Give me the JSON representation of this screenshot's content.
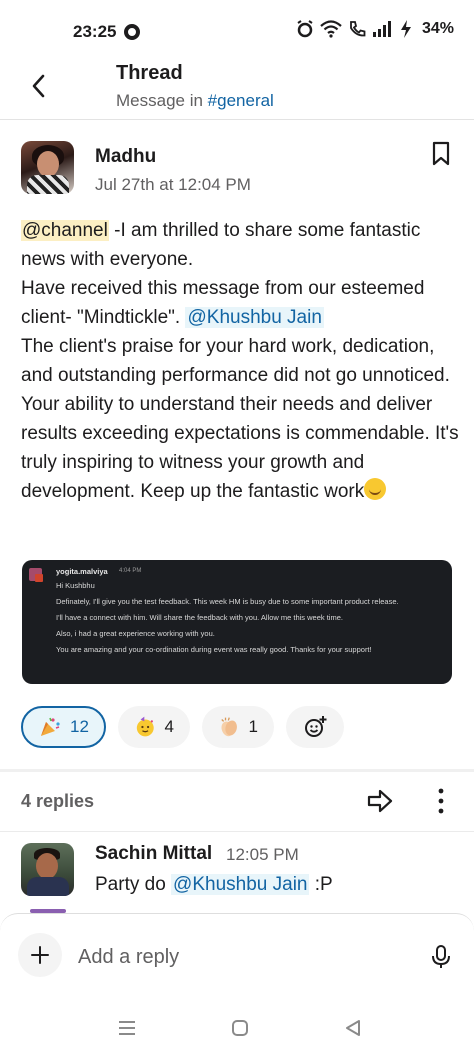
{
  "status_bar": {
    "time": "23:25",
    "battery": "34%",
    "icons": [
      "alarm-icon",
      "wifi-icon",
      "call-icon",
      "signal-icon",
      "charging-icon"
    ]
  },
  "header": {
    "title": "Thread",
    "subtitle_prefix": "Message in ",
    "channel": "#general"
  },
  "message": {
    "author": "Madhu",
    "time": "Jul 27th at 12:04 PM",
    "mention_channel": "@channel",
    "text_1": " -I am thrilled to share some fantastic news with everyone.",
    "text_2": "Have received this message from our esteemed client- \"Mindtickle\". ",
    "mention_user": "@Khushbu Jain",
    "text_3": "The client's praise for your hard work, dedication, and outstanding performance did not go unnoticed. Your ability to understand their needs and deliver results exceeding expectations is commendable. It's truly inspiring to witness your growth and development. Keep up the fantastic work",
    "emoji": "smiling-face-emoji"
  },
  "embed": {
    "name": "yogita.malviya",
    "time": "4:04 PM",
    "lines": [
      "Hi Kushbhu",
      "Definately, I'll give you the test feedback. This week HM is busy due to some important product release.",
      "I'll have a connect with him. Will share the feedback with you. Allow me this week time.",
      "Also, i had a great experience working with you.",
      "You are amazing and your co-ordination during event was really good. Thanks for your support!"
    ]
  },
  "reactions": [
    {
      "emoji": "party-popper-emoji",
      "count": "12",
      "active": true
    },
    {
      "emoji": "partying-face-emoji",
      "count": "4",
      "active": false
    },
    {
      "emoji": "clapping-hands-emoji",
      "count": "1",
      "active": false
    },
    {
      "emoji": "add-reaction-icon",
      "count": "",
      "active": false
    }
  ],
  "replies": {
    "count_label": "4 replies"
  },
  "reply": {
    "author": "Sachin Mittal",
    "time": "12:05 PM",
    "text_prefix": "Party do ",
    "mention_user": "@Khushbu Jain",
    "text_suffix": " :P"
  },
  "composer": {
    "placeholder": "Add a reply"
  },
  "colors": {
    "link": "#1264a3",
    "channel_highlight": "#fcefc3",
    "user_highlight": "#e8f5fa",
    "muted": "#616061"
  }
}
